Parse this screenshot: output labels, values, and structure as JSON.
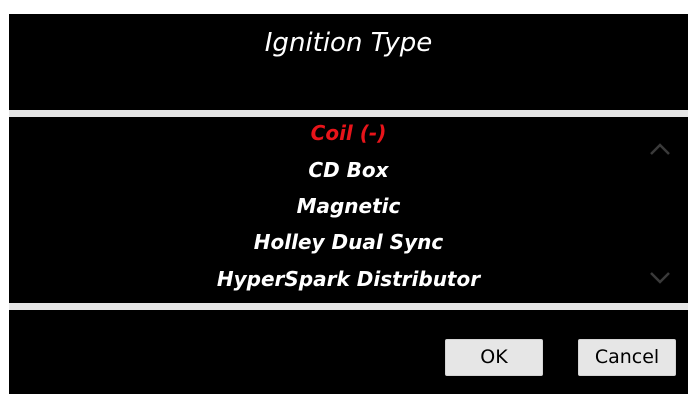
{
  "dialog": {
    "title": "Ignition Type",
    "options": [
      {
        "label": "Coil (-)",
        "selected": true
      },
      {
        "label": "CD Box",
        "selected": false
      },
      {
        "label": "Magnetic",
        "selected": false
      },
      {
        "label": "Holley Dual Sync",
        "selected": false
      },
      {
        "label": "HyperSpark Distributor",
        "selected": false
      }
    ],
    "scroll_up_icon": "chevron-up-icon",
    "scroll_down_icon": "chevron-down-icon",
    "buttons": {
      "ok_label": "OK",
      "cancel_label": "Cancel"
    }
  },
  "colors": {
    "background": "#000000",
    "selected_text": "#e8141a",
    "text": "#ffffff",
    "divider": "#e6e6e6",
    "button_bg": "#e6e6e6"
  }
}
